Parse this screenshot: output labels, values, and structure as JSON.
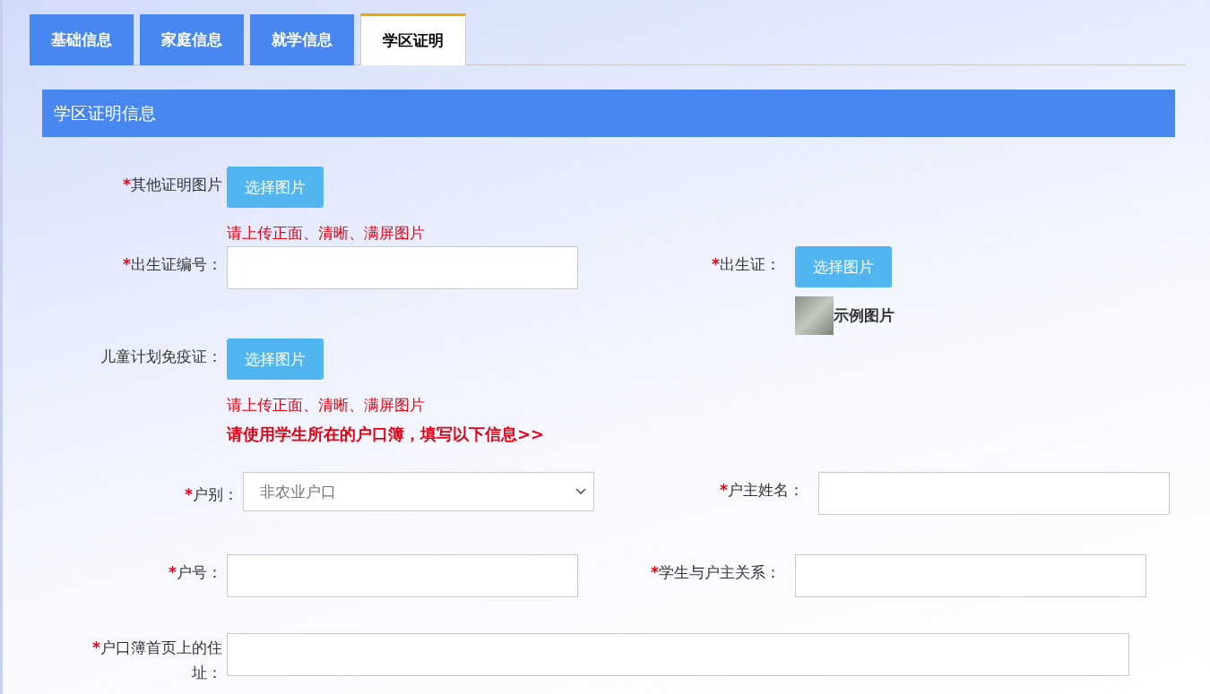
{
  "tabs": [
    {
      "label": "基础信息",
      "selected": false
    },
    {
      "label": "家庭信息",
      "selected": false
    },
    {
      "label": "就学信息",
      "selected": false
    },
    {
      "label": "学区证明",
      "selected": true
    }
  ],
  "section": {
    "title": "学区证明信息"
  },
  "rows": [
    {
      "cells": [
        {
          "kind": "upload",
          "mark": "*",
          "label": "其他证明图片",
          "button": "选择图片",
          "notes": [
            {
              "kind": "hint",
              "text": "请上传正面、清晰、满屏图片"
            }
          ]
        }
      ]
    },
    {
      "cells": [
        {
          "kind": "text",
          "mark": "*",
          "label": "出生证编号："
        },
        {
          "kind": "upload",
          "mark": "*",
          "label": "出生证：",
          "button": "选择图片",
          "sample": "示例图片"
        }
      ]
    },
    {
      "cells": [
        {
          "kind": "upload",
          "label": "儿童计划免疫证：",
          "button": "选择图片",
          "notes": [
            {
              "kind": "hint",
              "text": "请上传正面、清晰、满屏图片"
            },
            {
              "kind": "notice",
              "text": "请使用学生所在的户口簿，填写以下信息>>"
            }
          ]
        }
      ]
    },
    {
      "cells": [
        {
          "kind": "select",
          "mark": "*",
          "label": "户别：",
          "value": "非农业户口"
        },
        {
          "kind": "text",
          "mark": "*",
          "label": "户主姓名："
        }
      ]
    },
    {
      "cells": [
        {
          "kind": "text",
          "mark": "*",
          "label": "户号："
        },
        {
          "kind": "text",
          "mark": "*",
          "label": "学生与户主关系："
        }
      ]
    },
    {
      "cells": [
        {
          "kind": "wide",
          "mark": "*",
          "label": "户口簿首页上的住址："
        }
      ]
    }
  ]
}
